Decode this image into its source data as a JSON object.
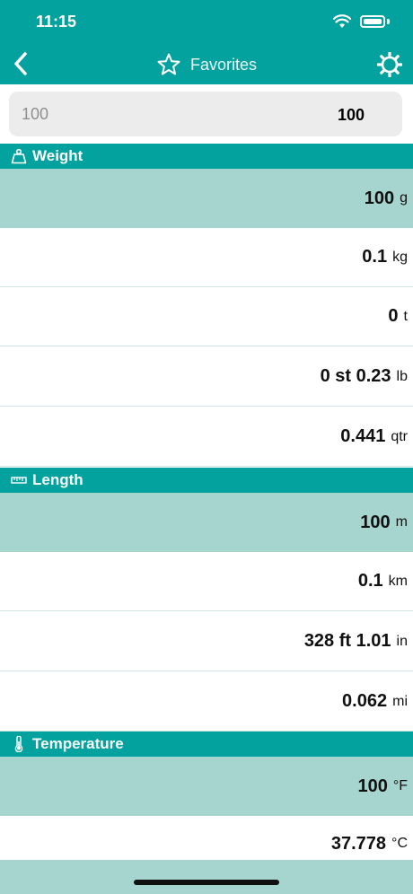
{
  "status": {
    "time": "11:15"
  },
  "nav": {
    "title": "Favorites"
  },
  "input": {
    "placeholder": "100",
    "value": "100"
  },
  "sections": [
    {
      "title": "Weight",
      "icon": "weight-icon",
      "rows": [
        {
          "value": "100",
          "unit": "g"
        },
        {
          "value": "0.1",
          "unit": "kg"
        },
        {
          "value": "0",
          "unit": "t"
        },
        {
          "value": "0 st 0.23",
          "unit": "lb"
        },
        {
          "value": "0.441",
          "unit": "qtr"
        }
      ]
    },
    {
      "title": "Length",
      "icon": "ruler-icon",
      "rows": [
        {
          "value": "100",
          "unit": "m"
        },
        {
          "value": "0.1",
          "unit": "km"
        },
        {
          "value": "328 ft 1.01",
          "unit": "in"
        },
        {
          "value": "0.062",
          "unit": "mi"
        }
      ]
    },
    {
      "title": "Temperature",
      "icon": "thermometer-icon",
      "rows": [
        {
          "value": "100",
          "unit": "°F"
        },
        {
          "value": "37.778",
          "unit": "°C"
        }
      ]
    }
  ],
  "colors": {
    "primary": "#03a29e",
    "highlight": "#a6d5d0"
  }
}
